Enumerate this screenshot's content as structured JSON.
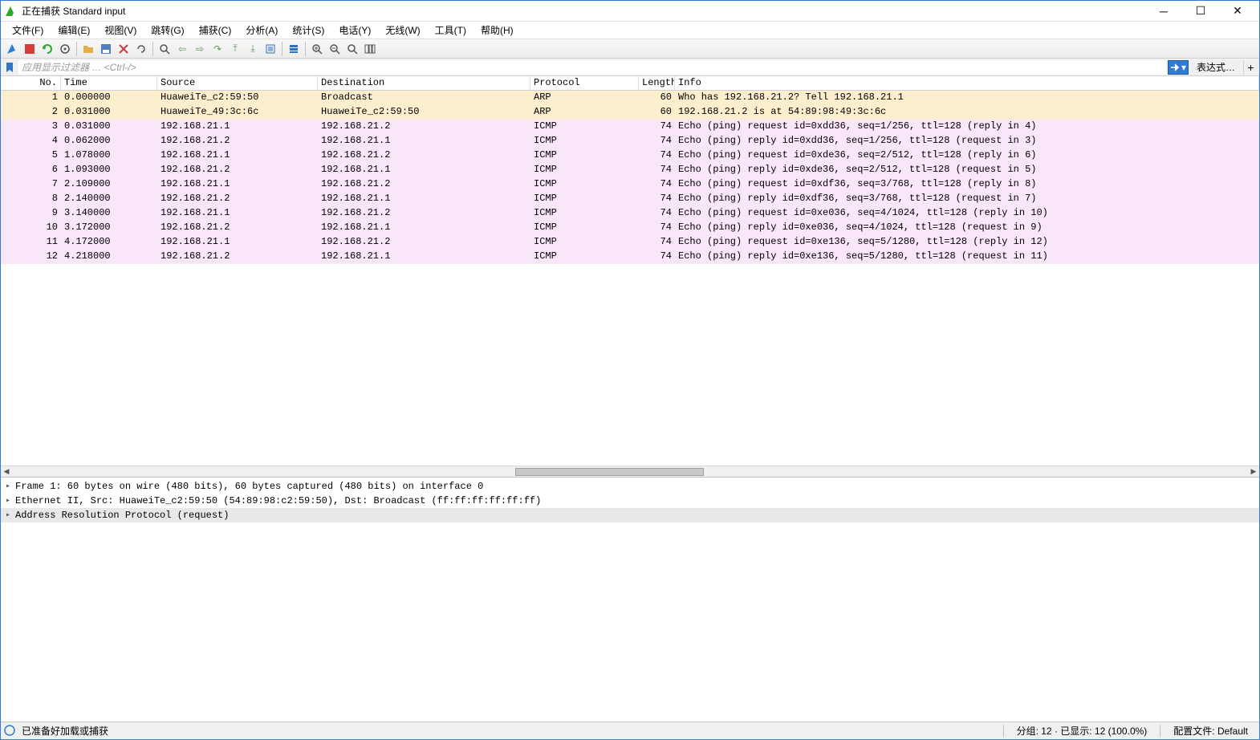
{
  "window": {
    "title": "正在捕获 Standard input"
  },
  "menu": {
    "file": "文件(F)",
    "edit": "编辑(E)",
    "view": "视图(V)",
    "go": "跳转(G)",
    "capture": "捕获(C)",
    "analyze": "分析(A)",
    "statistics": "统计(S)",
    "telephony": "电话(Y)",
    "wireless": "无线(W)",
    "tools": "工具(T)",
    "help": "帮助(H)"
  },
  "filter": {
    "placeholder": "应用显示过滤器 … <Ctrl-/>",
    "expression": "表达式…"
  },
  "columns": {
    "no": "No.",
    "time": "Time",
    "source": "Source",
    "destination": "Destination",
    "protocol": "Protocol",
    "length": "Length",
    "info": "Info"
  },
  "packets": [
    {
      "no": "1",
      "time": "0.000000",
      "src": "HuaweiTe_c2:59:50",
      "dst": "Broadcast",
      "proto": "ARP",
      "len": "60",
      "info": "Who has 192.168.21.2? Tell 192.168.21.1",
      "cls": "row-arp"
    },
    {
      "no": "2",
      "time": "0.031000",
      "src": "HuaweiTe_49:3c:6c",
      "dst": "HuaweiTe_c2:59:50",
      "proto": "ARP",
      "len": "60",
      "info": "192.168.21.2 is at 54:89:98:49:3c:6c",
      "cls": "row-arp"
    },
    {
      "no": "3",
      "time": "0.031000",
      "src": "192.168.21.1",
      "dst": "192.168.21.2",
      "proto": "ICMP",
      "len": "74",
      "info": "Echo (ping) request  id=0xdd36, seq=1/256, ttl=128 (reply in 4)",
      "cls": "row-icmp"
    },
    {
      "no": "4",
      "time": "0.062000",
      "src": "192.168.21.2",
      "dst": "192.168.21.1",
      "proto": "ICMP",
      "len": "74",
      "info": "Echo (ping) reply    id=0xdd36, seq=1/256, ttl=128 (request in 3)",
      "cls": "row-icmp"
    },
    {
      "no": "5",
      "time": "1.078000",
      "src": "192.168.21.1",
      "dst": "192.168.21.2",
      "proto": "ICMP",
      "len": "74",
      "info": "Echo (ping) request  id=0xde36, seq=2/512, ttl=128 (reply in 6)",
      "cls": "row-icmp"
    },
    {
      "no": "6",
      "time": "1.093000",
      "src": "192.168.21.2",
      "dst": "192.168.21.1",
      "proto": "ICMP",
      "len": "74",
      "info": "Echo (ping) reply    id=0xde36, seq=2/512, ttl=128 (request in 5)",
      "cls": "row-icmp"
    },
    {
      "no": "7",
      "time": "2.109000",
      "src": "192.168.21.1",
      "dst": "192.168.21.2",
      "proto": "ICMP",
      "len": "74",
      "info": "Echo (ping) request  id=0xdf36, seq=3/768, ttl=128 (reply in 8)",
      "cls": "row-icmp"
    },
    {
      "no": "8",
      "time": "2.140000",
      "src": "192.168.21.2",
      "dst": "192.168.21.1",
      "proto": "ICMP",
      "len": "74",
      "info": "Echo (ping) reply    id=0xdf36, seq=3/768, ttl=128 (request in 7)",
      "cls": "row-icmp"
    },
    {
      "no": "9",
      "time": "3.140000",
      "src": "192.168.21.1",
      "dst": "192.168.21.2",
      "proto": "ICMP",
      "len": "74",
      "info": "Echo (ping) request  id=0xe036, seq=4/1024, ttl=128 (reply in 10)",
      "cls": "row-icmp"
    },
    {
      "no": "10",
      "time": "3.172000",
      "src": "192.168.21.2",
      "dst": "192.168.21.1",
      "proto": "ICMP",
      "len": "74",
      "info": "Echo (ping) reply    id=0xe036, seq=4/1024, ttl=128 (request in 9)",
      "cls": "row-icmp"
    },
    {
      "no": "11",
      "time": "4.172000",
      "src": "192.168.21.1",
      "dst": "192.168.21.2",
      "proto": "ICMP",
      "len": "74",
      "info": "Echo (ping) request  id=0xe136, seq=5/1280, ttl=128 (reply in 12)",
      "cls": "row-icmp"
    },
    {
      "no": "12",
      "time": "4.218000",
      "src": "192.168.21.2",
      "dst": "192.168.21.1",
      "proto": "ICMP",
      "len": "74",
      "info": "Echo (ping) reply    id=0xe136, seq=5/1280, ttl=128 (request in 11)",
      "cls": "row-icmp"
    }
  ],
  "details": {
    "frame": "Frame 1: 60 bytes on wire (480 bits), 60 bytes captured (480 bits) on interface 0",
    "eth": "Ethernet II, Src: HuaweiTe_c2:59:50 (54:89:98:c2:59:50), Dst: Broadcast (ff:ff:ff:ff:ff:ff)",
    "arp": "Address Resolution Protocol (request)"
  },
  "status": {
    "ready": "已准备好加载或捕获",
    "packets": "分组: 12 · 已显示: 12 (100.0%)",
    "profile": "配置文件: Default"
  }
}
